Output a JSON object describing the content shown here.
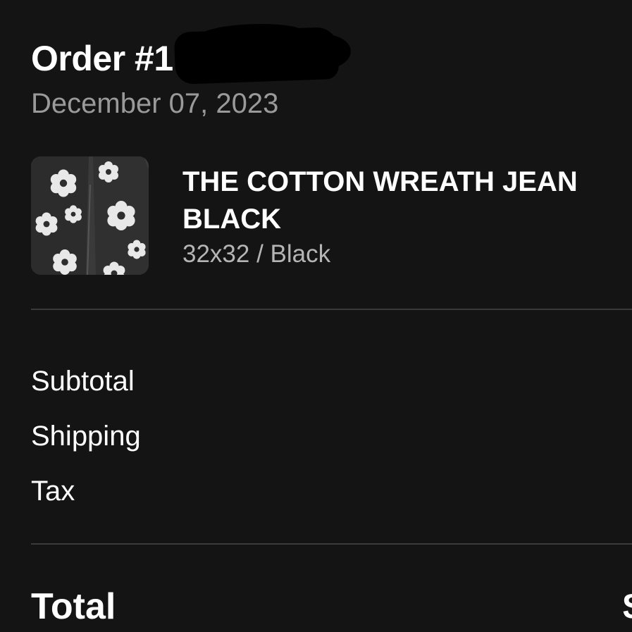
{
  "order": {
    "title": "Order #1",
    "date": "December 07, 2023"
  },
  "product": {
    "name": "THE COTTON WREATH JEAN BLACK",
    "variant": "32x32 / Black",
    "thumbnail_icon": "jeans-product-image"
  },
  "summary": {
    "labels": [
      "Subtotal",
      "Shipping",
      "Tax"
    ]
  },
  "total": {
    "label": "Total",
    "value": "$"
  },
  "colors": {
    "background": "#141414",
    "primary_text": "#ffffff",
    "secondary_text": "#9a9a9a",
    "divider": "#3a3a3a"
  }
}
